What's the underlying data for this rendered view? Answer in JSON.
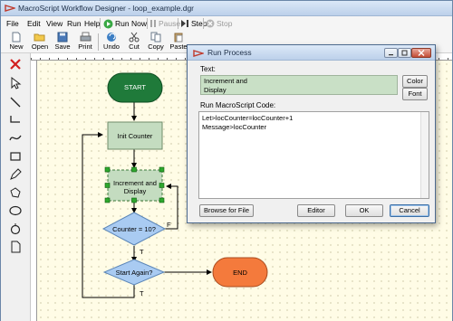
{
  "window": {
    "title": "MacroScript Workflow Designer - loop_example.dgr"
  },
  "menu": [
    "File",
    "Edit",
    "View",
    "Run",
    "Help"
  ],
  "run_controls": {
    "run_now": "Run Now",
    "pause": "Pause",
    "step": "Step",
    "stop": "Stop"
  },
  "toolbar": [
    "New",
    "Open",
    "Save",
    "Print",
    "Undo",
    "Cut",
    "Copy",
    "Paste"
  ],
  "flowchart": {
    "start": "START",
    "init": "Init Counter",
    "increment": "Increment and Display",
    "decision1": "Counter = 10?",
    "decision2": "Start Again?",
    "end": "END",
    "label_t1": "T",
    "label_f1": "F",
    "label_t2": "T"
  },
  "dialog": {
    "title": "Run Process",
    "text_label": "Text:",
    "text_value_line1": "Increment and",
    "text_value_line2": "Display",
    "color_button": "Color",
    "font_button": "Font",
    "code_label": "Run MacroScript Code:",
    "code_line1": "Let>locCounter=locCounter+1",
    "code_line2": "Message>locCounter",
    "browse_button": "Browse for File",
    "editor_button": "Editor",
    "ok_button": "OK",
    "cancel_button": "Cancel"
  },
  "colors": {
    "start_fill": "#1f7a3a",
    "process_fill": "#c4dcc0",
    "decision_fill": "#a9cbf2",
    "end_fill": "#f47a3c",
    "canvas_bg": "#fffce6",
    "selection_handle": "#2ea82e"
  }
}
